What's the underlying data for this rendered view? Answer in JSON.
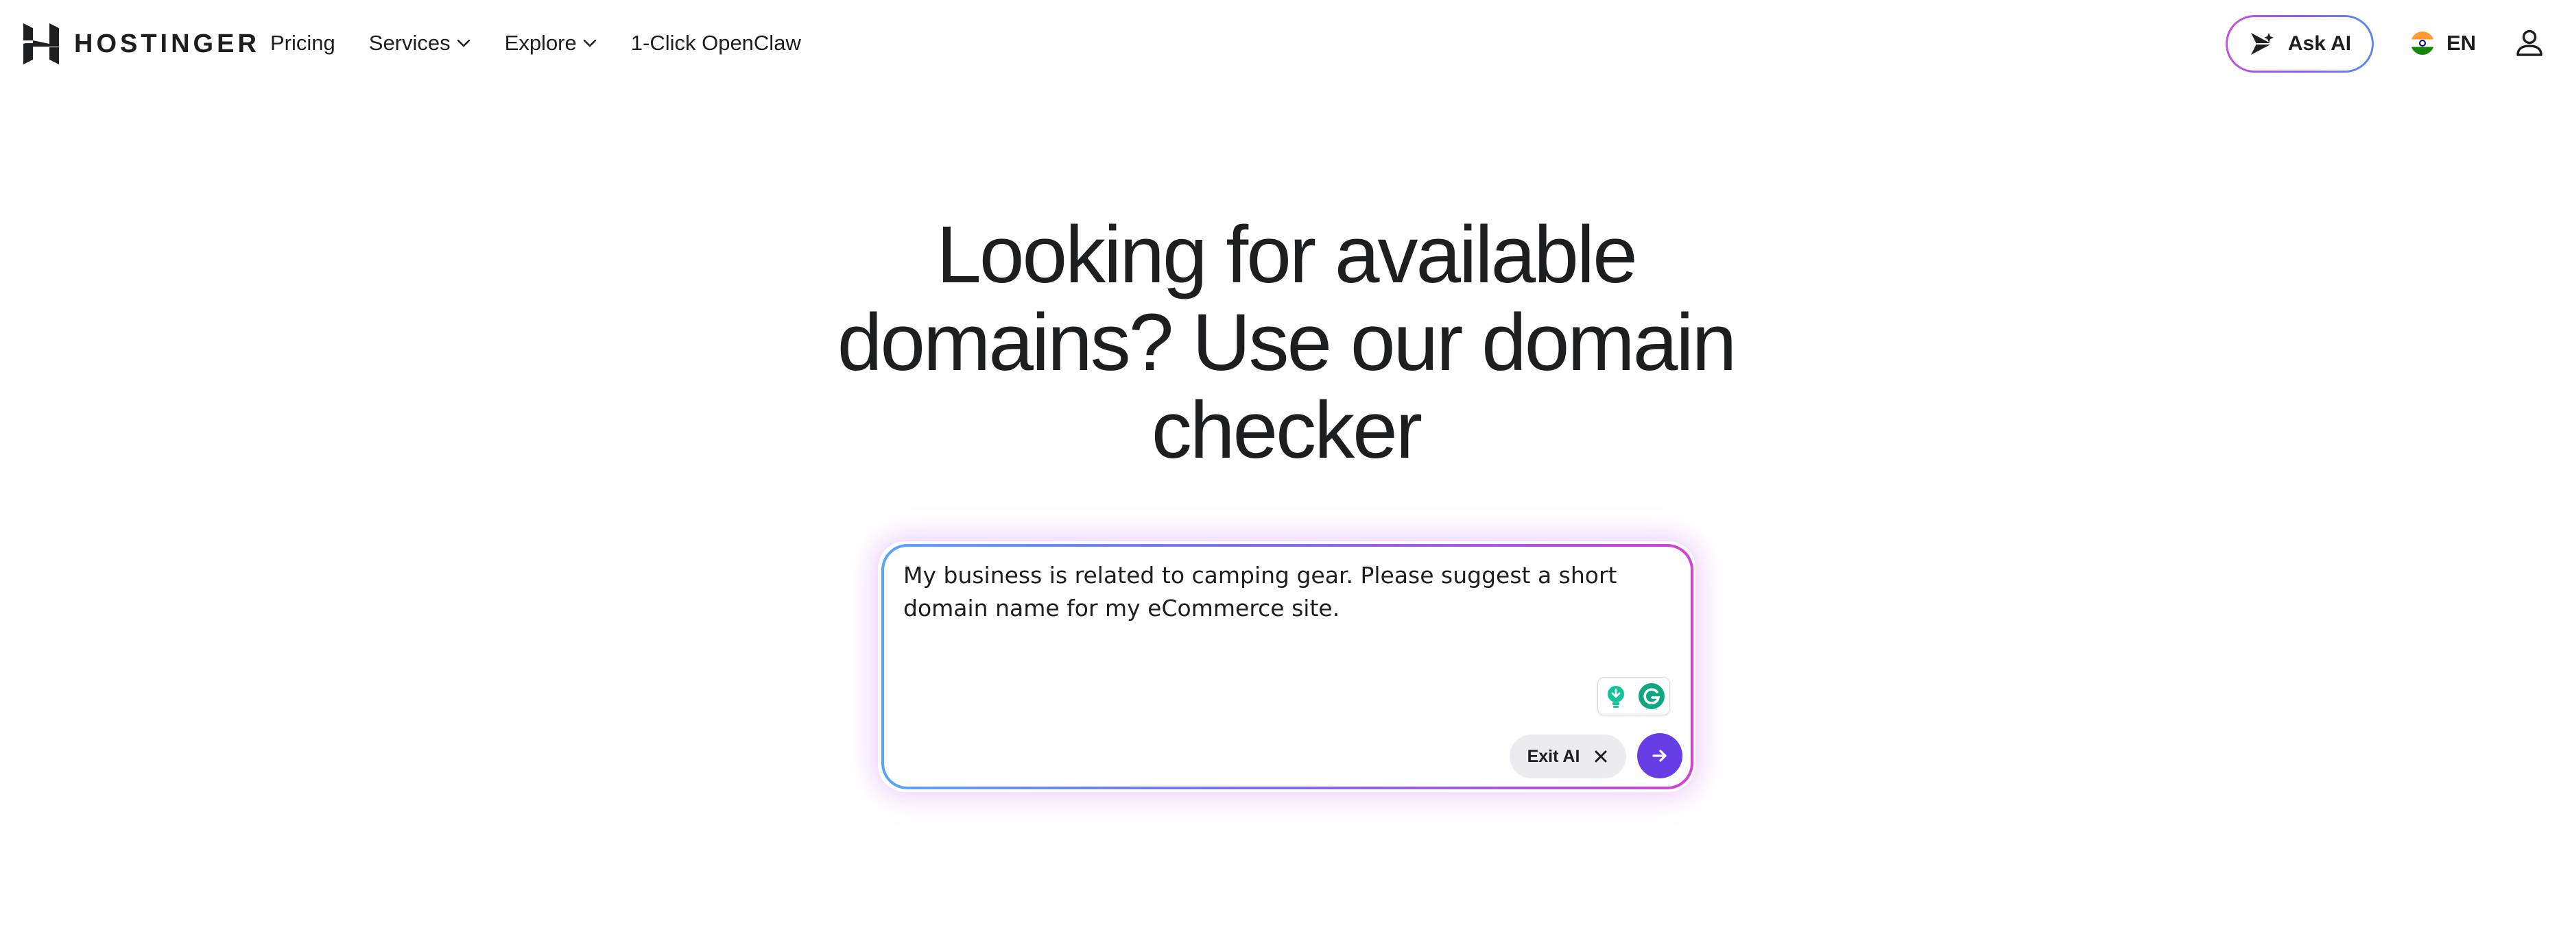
{
  "header": {
    "logo_text": "HOSTINGER",
    "logo_icon": "hostinger-logo-icon",
    "nav": [
      {
        "label": "Pricing",
        "dropdown": false
      },
      {
        "label": "Services",
        "dropdown": true
      },
      {
        "label": "Explore",
        "dropdown": true
      },
      {
        "label": "1-Click OpenClaw",
        "dropdown": false
      }
    ],
    "ask_ai_label": "Ask AI",
    "ask_ai_icon": "sparkle-icon",
    "language_label": "EN",
    "language_flag_icon": "india-flag-icon",
    "account_icon": "user-icon"
  },
  "hero": {
    "title": "Looking for available domains? Use our domain checker"
  },
  "search": {
    "value": "My business is related to camping gear. Please suggest a short domain name for my eCommerce site.",
    "exit_ai_label": "Exit AI",
    "exit_icon": "close-icon",
    "submit_icon": "arrow-right-icon",
    "extension_icons": [
      "lightbulb-icon",
      "grammarly-icon"
    ]
  },
  "colors": {
    "brand_purple": "#673de6",
    "text": "#1d1e20",
    "gradient_start": "#56a6f4",
    "gradient_end": "#d243d6"
  }
}
